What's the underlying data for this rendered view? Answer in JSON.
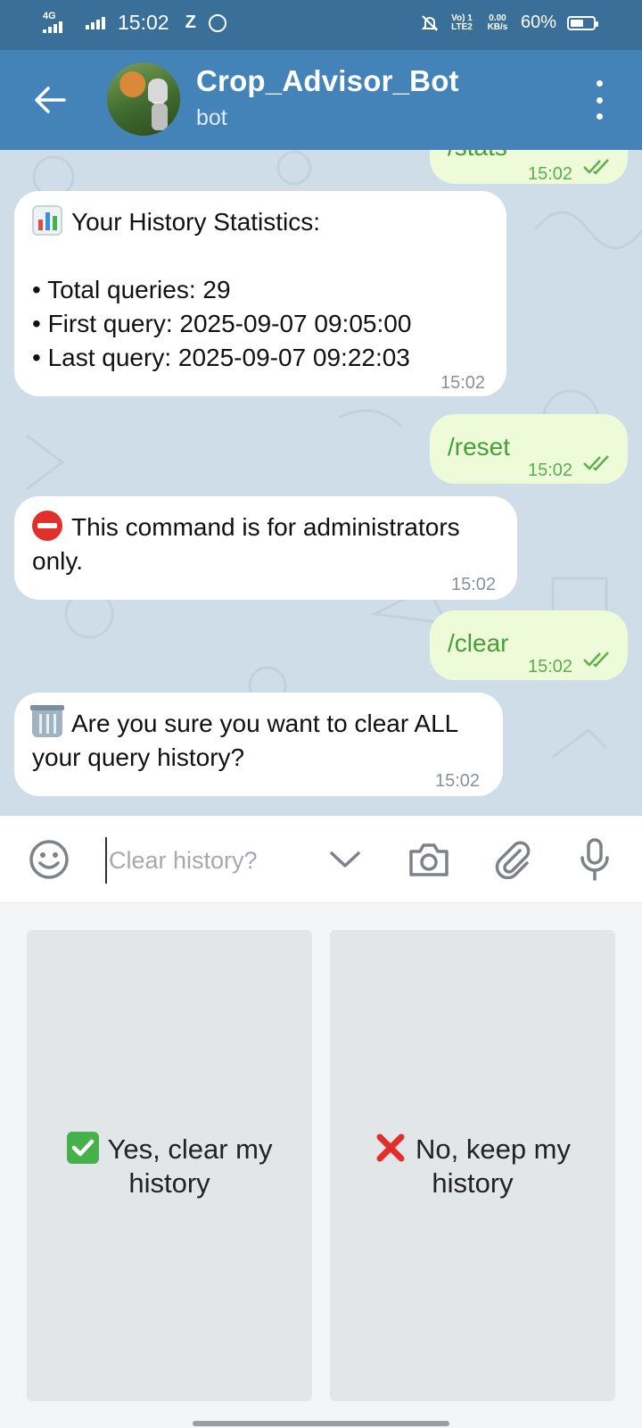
{
  "status_bar": {
    "network": "4G",
    "time": "15:02",
    "z_label": "Z",
    "volte": "Vo) 1 LTE2",
    "data_rate": "0.00 KB/s",
    "battery_percent": "60%",
    "battery_level": 0.6
  },
  "header": {
    "title": "Crop_Advisor_Bot",
    "subtitle": "bot"
  },
  "messages": [
    {
      "type": "outgoing",
      "text": "/stats",
      "time": "15:02"
    },
    {
      "type": "incoming",
      "emoji": "bar-chart-emoji",
      "lines": [
        "Your History Statistics:",
        "",
        "• Total queries: 29",
        "• First query: 2025-09-07 09:05:00",
        "• Last query: 2025-09-07 09:22:03"
      ],
      "time": "15:02"
    },
    {
      "type": "outgoing",
      "text": "/reset",
      "time": "15:02"
    },
    {
      "type": "incoming",
      "emoji": "no-entry-emoji",
      "lines": [
        "This command is for administrators",
        "only."
      ],
      "time": "15:02"
    },
    {
      "type": "outgoing",
      "text": "/clear",
      "time": "15:02"
    },
    {
      "type": "incoming",
      "emoji": "wastebasket-emoji",
      "lines": [
        "Are you sure you want to clear ALL",
        "your query history?"
      ],
      "time": "15:02"
    }
  ],
  "input": {
    "placeholder": "Clear history?"
  },
  "keyboard": {
    "yes_label": "Yes, clear my history",
    "no_label": "No, keep my history"
  },
  "colors": {
    "status_bar": "#3a6f9a",
    "header": "#4383b8",
    "incoming_bubble": "#ffffff",
    "outgoing_bubble": "#eefbd9",
    "outgoing_text": "#46a036",
    "chat_background": "#cfdde8"
  }
}
